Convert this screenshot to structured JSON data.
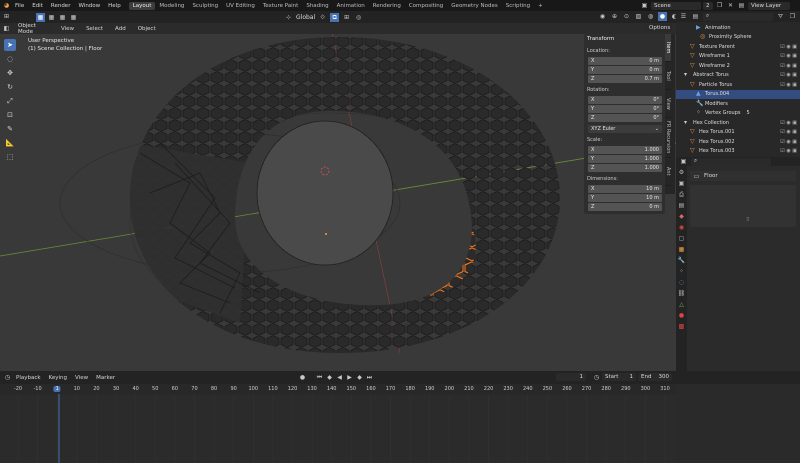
{
  "topbar": {
    "menus": [
      "File",
      "Edit",
      "Render",
      "Window",
      "Help"
    ],
    "workspaces": [
      "Layout",
      "Modeling",
      "Sculpting",
      "UV Editing",
      "Texture Paint",
      "Shading",
      "Animation",
      "Rendering",
      "Compositing",
      "Geometry Nodes",
      "Scripting"
    ],
    "add_tab": "+",
    "scene": "Scene",
    "scene_users": "2",
    "view_layer": "View Layer"
  },
  "viewport_header": {
    "mode": "Object Mode",
    "menus": [
      "View",
      "Select",
      "Add",
      "Object"
    ],
    "orientation": "Global",
    "options": "Options"
  },
  "viewport": {
    "perspective": "User Perspective",
    "collection": "(1) Scene Collection | Floor"
  },
  "npanel": {
    "header": "Transform",
    "location_label": "Location:",
    "location": [
      {
        "axis": "X",
        "value": "0 m"
      },
      {
        "axis": "Y",
        "value": "0 m"
      },
      {
        "axis": "Z",
        "value": "0.7 m"
      }
    ],
    "rotation_label": "Rotation:",
    "rotation": [
      {
        "axis": "X",
        "value": "0°"
      },
      {
        "axis": "Y",
        "value": "0°"
      },
      {
        "axis": "Z",
        "value": "0°"
      }
    ],
    "rotation_mode": "XYZ Euler",
    "scale_label": "Scale:",
    "scale": [
      {
        "axis": "X",
        "value": "1.000"
      },
      {
        "axis": "Y",
        "value": "1.000"
      },
      {
        "axis": "Z",
        "value": "1.000"
      }
    ],
    "dimensions_label": "Dimensions:",
    "dimensions": [
      {
        "axis": "X",
        "value": "10 m"
      },
      {
        "axis": "Y",
        "value": "10 m"
      },
      {
        "axis": "Z",
        "value": "0 m"
      }
    ],
    "tabs": [
      "Item",
      "Tool",
      "View",
      "FR Recursion",
      "Ant"
    ]
  },
  "outliner": {
    "items": [
      {
        "label": "Animation",
        "color": "#6aa0e8"
      },
      {
        "label": "Proximity Sphere",
        "color": "#e89a4a"
      },
      {
        "label": "Texture Parent",
        "color": "#e89a4a"
      },
      {
        "label": "Wireframe 1",
        "color": "#e89a4a"
      },
      {
        "label": "Wireframe 2",
        "color": "#e89a4a"
      },
      {
        "label": "Abstract Torus",
        "color": "#cfcfcf"
      },
      {
        "label": "Particle Torus",
        "color": "#e89a4a"
      },
      {
        "label": "Torus.004",
        "color": "#6aa0e8"
      },
      {
        "label": "Modifiers",
        "color": "#6aa0e8"
      },
      {
        "label": "Vertex Groups",
        "color": "#cfcfcf"
      },
      {
        "label": "Hex Collection",
        "color": "#cfcfcf"
      },
      {
        "label": "Hex Torus.001",
        "color": "#e89a4a"
      },
      {
        "label": "Hex Torus.002",
        "color": "#e89a4a"
      },
      {
        "label": "Hex Torus.003",
        "color": "#e89a4a"
      }
    ],
    "vertex_groups_count": "5"
  },
  "properties": {
    "object_name": "Floor",
    "search_placeholder": ""
  },
  "timeline": {
    "menus": [
      "Playback",
      "Keying",
      "View",
      "Marker"
    ],
    "current_frame": "1",
    "start_label": "Start",
    "start": "1",
    "end_label": "End",
    "end": "300",
    "ruler": [
      "-20",
      "-10",
      "1",
      "10",
      "20",
      "30",
      "40",
      "50",
      "60",
      "70",
      "80",
      "90",
      "100",
      "110",
      "120",
      "130",
      "140",
      "150",
      "160",
      "170",
      "180",
      "190",
      "200",
      "210",
      "220",
      "230",
      "240",
      "250",
      "260",
      "270",
      "280",
      "290",
      "300",
      "310"
    ]
  },
  "colors": {
    "accent": "#4772b3",
    "selection": "#ff8a1f",
    "frame_marker": "#4772b3"
  }
}
